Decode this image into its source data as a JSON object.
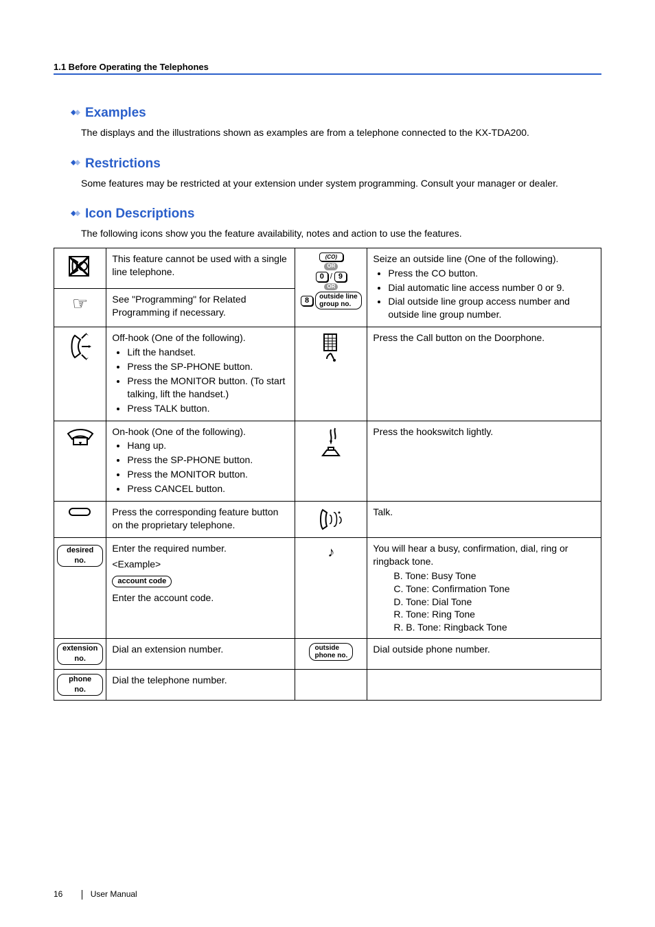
{
  "header": {
    "section": "1.1 Before Operating the Telephones"
  },
  "sections": {
    "examples": {
      "title": "Examples",
      "body": "The displays and the illustrations shown as examples are from a telephone connected to the KX-TDA200."
    },
    "restrictions": {
      "title": "Restrictions",
      "body": "Some features may be restricted at your extension under system programming. Consult your manager or dealer."
    },
    "icons": {
      "title": "Icon Descriptions",
      "body": "The following icons show you the feature availability, notes and action to use the features."
    }
  },
  "table": {
    "r1c1": "This feature cannot be used with a single line telephone.",
    "r1c2": "See \"Programming\" for Related Programming if necessary.",
    "seize": {
      "lead": "Seize an outside line (One of the following).",
      "b1": "Press the CO button.",
      "b2": "Dial automatic line access number 0 or 9.",
      "b3": "Dial outside line group access number and outside line group number.",
      "icon_co": "(CO)",
      "icon_or": "OR",
      "icon_line1": "outside line",
      "icon_line2": "group no."
    },
    "offhook": {
      "lead": "Off-hook (One of the following).",
      "b1": "Lift the handset.",
      "b2": "Press the SP-PHONE button.",
      "b3": "Press the MONITOR button. (To start talking, lift the handset.)",
      "b4": "Press TALK button."
    },
    "doorphone": "Press the Call button on the Doorphone.",
    "onhook": {
      "lead": "On-hook (One of the following).",
      "b1": "Hang up.",
      "b2": "Press the SP-PHONE button.",
      "b3": "Press the MONITOR button.",
      "b4": "Press CANCEL button."
    },
    "hookswitch": "Press the hookswitch lightly.",
    "featurebtn": "Press the corresponding feature button on the proprietary telephone.",
    "talk": "Talk.",
    "desiredno": {
      "label": "desired no.",
      "lead": "Enter the required number.",
      "example": "<Example>",
      "account_label": "account code",
      "account_text": "Enter the account code."
    },
    "tones": {
      "lead": "You will hear a busy, confirmation, dial, ring or ringback tone.",
      "t1": "B. Tone: Busy Tone",
      "t2": "C. Tone: Confirmation Tone",
      "t3": "D. Tone: Dial Tone",
      "t4": "R. Tone: Ring Tone",
      "t5": "R. B. Tone: Ringback Tone"
    },
    "extno": {
      "label": "extension no.",
      "text": "Dial an extension number."
    },
    "outsideno": {
      "label1": "outside",
      "label2": "phone no.",
      "text": "Dial outside phone number."
    },
    "phoneno": {
      "label": "phone no.",
      "text": "Dial the telephone number."
    }
  },
  "footer": {
    "page": "16",
    "label": "User Manual"
  }
}
